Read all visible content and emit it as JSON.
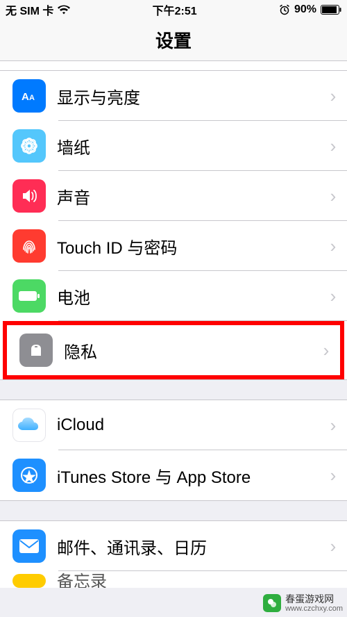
{
  "status_bar": {
    "carrier": "无 SIM 卡",
    "time": "下午2:51",
    "battery_pct": "90%"
  },
  "nav": {
    "title": "设置"
  },
  "group1": {
    "display": "显示与亮度",
    "wallpaper": "墙纸",
    "sounds": "声音",
    "touchid": "Touch ID 与密码",
    "battery": "电池",
    "privacy": "隐私"
  },
  "group2": {
    "icloud": "iCloud",
    "itunes": "iTunes Store 与 App Store"
  },
  "group3": {
    "mail": "邮件、通讯录、日历",
    "notes_peek": "备忘录"
  },
  "colors": {
    "blue": "#007aff",
    "cyan": "#5ac8fa",
    "red": "#ff3b30",
    "green": "#4cd964",
    "grey": "#8e8e93",
    "appstore": "#1e90ff",
    "mail": "#1e90ff",
    "yellow": "#ffcc00"
  },
  "watermark": {
    "name": "春蛋游戏网",
    "url": "www.czchxy.com"
  }
}
